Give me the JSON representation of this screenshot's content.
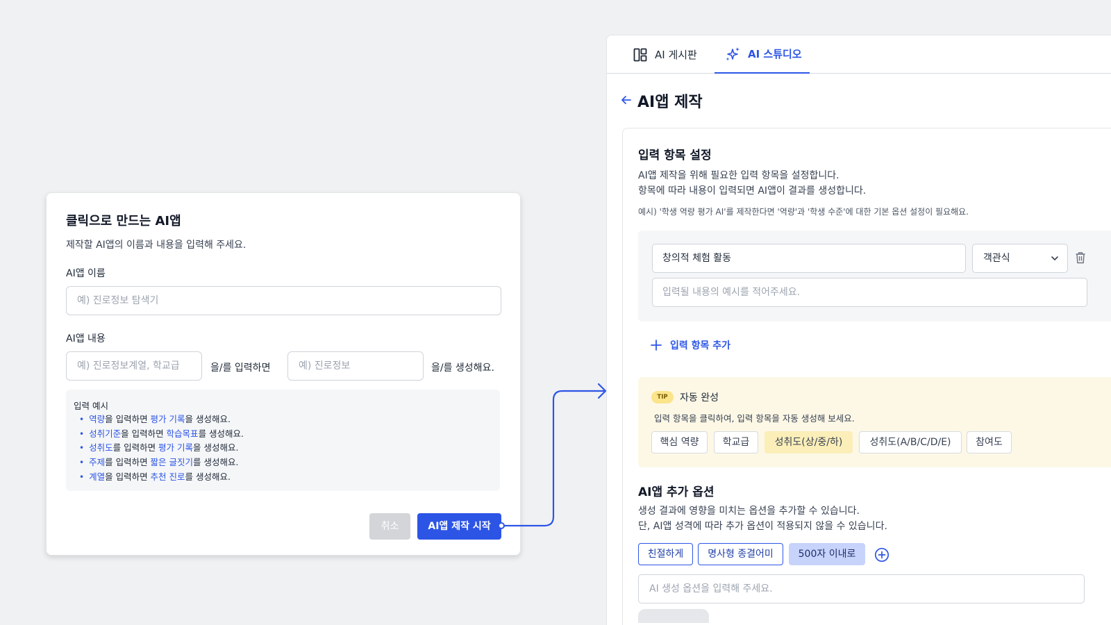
{
  "colors": {
    "accent": "#2c55e6",
    "tip_bg": "#fdf8e6",
    "page_bg": "#f0f1f3"
  },
  "modal": {
    "title": "클릭으로 만드는 AI앱",
    "description": "제작할 AI앱의 이름과 내용을 입력해 주세요.",
    "name_label": "AI앱 이름",
    "name_placeholder": "예) 진로정보 탐색기",
    "content_label": "AI앱 내용",
    "input_placeholder": "예) 진로정보계열, 학교급",
    "input_suffix": "을/를 입력하면",
    "output_placeholder": "예) 진로정보",
    "output_suffix": "을/를 생성해요.",
    "examples_title": "입력 예시",
    "examples": [
      {
        "input": "역량",
        "mid": "을 입력하면 ",
        "output": "평가 기록",
        "end": "을 생성해요."
      },
      {
        "input": "성취기준",
        "mid": "을 입력하면 ",
        "output": "학습목표",
        "end": "를 생성해요."
      },
      {
        "input": "성취도",
        "mid": "를 입력하면 ",
        "output": "평가 기록",
        "end": "을 생성해요."
      },
      {
        "input": "주제",
        "mid": "를 입력하면 ",
        "output": "짧은 글짓기",
        "end": "를 생성해요."
      },
      {
        "input": "계열",
        "mid": "을 입력하면 ",
        "output": "추천 진로",
        "end": "를 생성해요."
      }
    ],
    "cancel_label": "취소",
    "start_label": "AI앱 제작 시작"
  },
  "panel": {
    "tabs": [
      {
        "label": "AI 게시판",
        "icon": "board-icon"
      },
      {
        "label": "AI 스튜디오",
        "icon": "sparkle-icon"
      }
    ],
    "page_title": "AI앱 제작",
    "input_section": {
      "title": "입력 항목 설정",
      "desc_line1": "AI앱 제작을 위해 필요한 입력 항목을 설정합니다.",
      "desc_line2": "항목에 따라 내용이 입력되면 AI앱이 결과를 생성합니다.",
      "example": "예시) '학생 역량 평가 AI'를 제작한다면 '역량'과 '학생 수준'에 대한 기본 옵션 설정이 필요해요.",
      "item_name": "창의적 체험 활동",
      "item_type": "객관식",
      "item_example_placeholder": "입력될 내용의 예시를 적어주세요.",
      "add_label": "입력 항목 추가"
    },
    "tip": {
      "badge": "TIP",
      "title": "자동 완성",
      "description": "입력 항목을 클릭하여, 입력 항목을 자동 생성해 보세요.",
      "chips": [
        "핵심 역량",
        "학교급",
        "성취도(상/중/하)",
        "성취도(A/B/C/D/E)",
        "참여도"
      ],
      "active_chip": "성취도(상/중/하)"
    },
    "options_section": {
      "title": "AI앱 추가 옵션",
      "desc_line1": "생성 결과에 영향을 미치는 옵션을 추가할 수 있습니다.",
      "desc_line2": "단, AI앱 성격에 따라 추가 옵션이 적용되지 않을 수 있습니다.",
      "chips": [
        "친절하게",
        "명사형 종결어미",
        "500자 이내로"
      ],
      "input_placeholder": "AI 생성 옵션을 입력해 주세요."
    }
  }
}
